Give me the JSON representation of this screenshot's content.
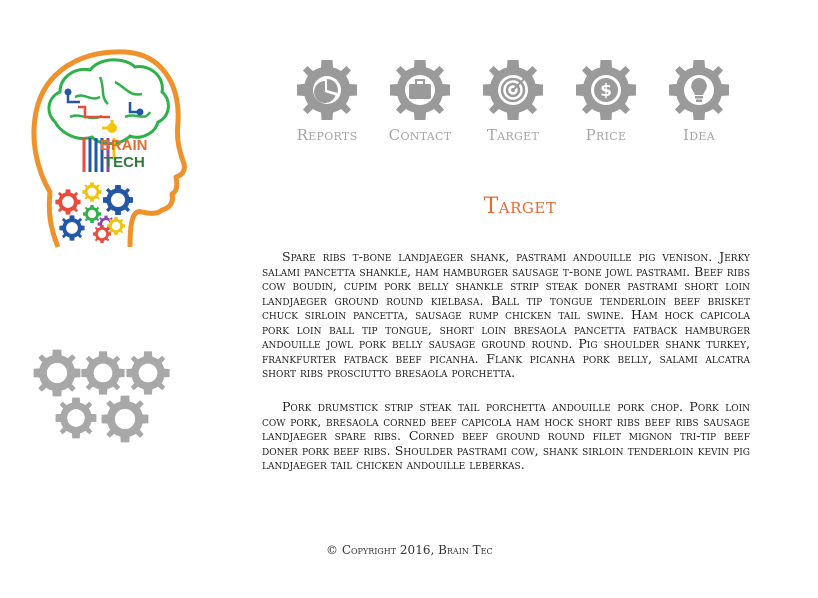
{
  "brand": {
    "line1": "BRAIN",
    "line2": "TECH"
  },
  "nav": {
    "items": [
      {
        "label": "Reports",
        "icon": "pie-chart-icon"
      },
      {
        "label": "Contact",
        "icon": "briefcase-icon"
      },
      {
        "label": "Target",
        "icon": "target-icon"
      },
      {
        "label": "Price",
        "icon": "dollar-icon"
      },
      {
        "label": "Idea",
        "icon": "lightbulb-icon"
      }
    ]
  },
  "main": {
    "title": "Target",
    "paragraphs": [
      "Spare ribs t-bone landjaeger shank, pastrami andouille pig venison. Jerky salami pancetta shankle, ham hamburger sausage t-bone jowl pastrami. Beef ribs cow boudin, cupim pork belly shankle strip steak doner pastrami short loin landjaeger ground round kielbasa. Ball tip tongue tenderloin beef brisket chuck sirloin pancetta, sausage rump chicken tail swine. Ham hock capicola pork loin ball tip tongue, short loin bresaola pancetta fatback hamburger andouille jowl pork belly sausage ground round. Pig shoulder shank turkey, frankfurter fatback beef picanha. Flank picanha pork belly, salami alcatra short ribs prosciutto bresaola porchetta.",
      "Pork drumstick strip steak tail porchetta andouille pork chop. Pork loin cow pork, bresaola corned beef capicola ham hock short ribs beef ribs sausage landjaeger spare ribs. Corned beef ground round filet mignon tri-tip beef doner pork beef ribs. Shoulder pastrami cow, shank sirloin tenderloin kevin pig landjaeger tail chicken andouille leberkas."
    ]
  },
  "footer": {
    "text": "© Copyright 2016, Brain Tec"
  },
  "colors": {
    "accent": "#e86a33",
    "gear_gray": "#9a9a9a",
    "nav_label": "#a6a6a6"
  }
}
